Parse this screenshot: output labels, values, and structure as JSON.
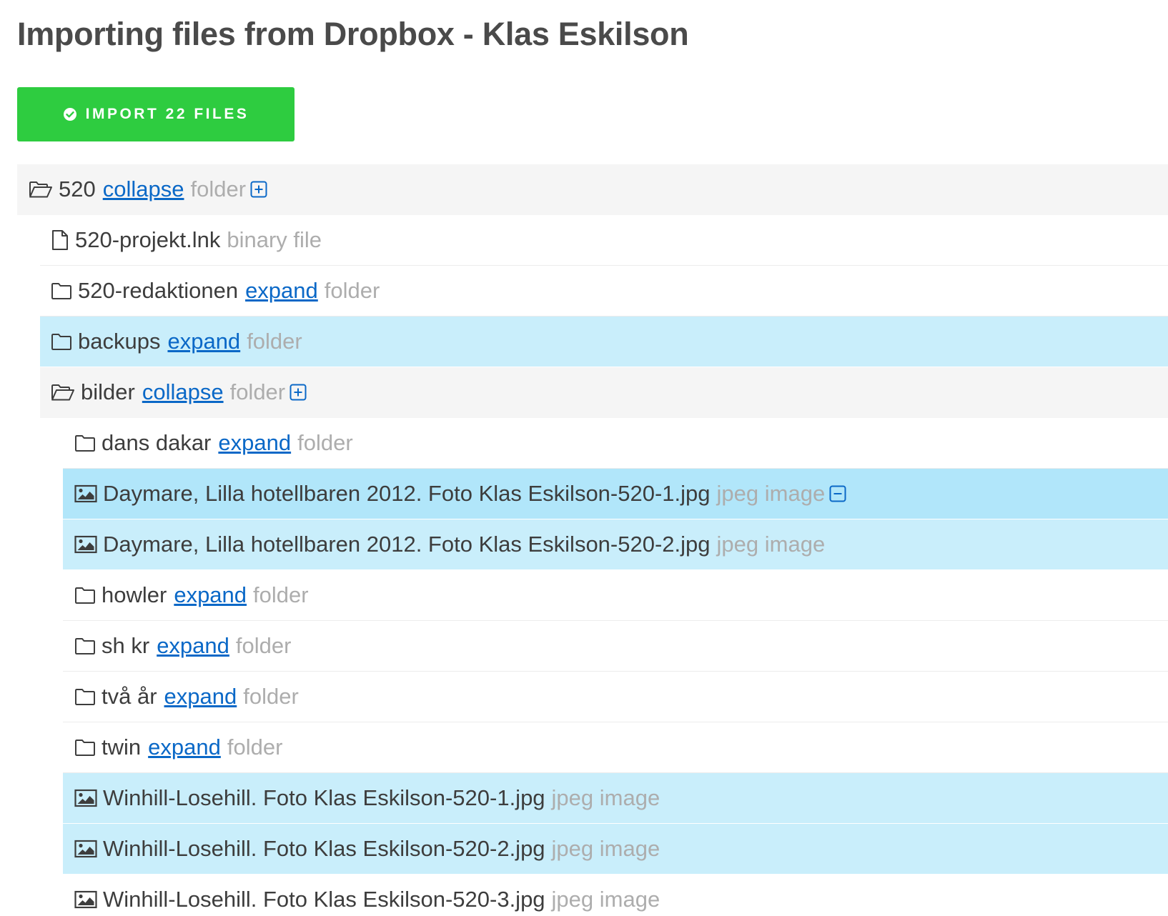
{
  "page": {
    "title": "Importing files from Dropbox - Klas Eskilson"
  },
  "import_button": {
    "icon": "check-circle-icon",
    "label": "IMPORT 22 FILES"
  },
  "colors": {
    "accent_green": "#2ecc40",
    "link_blue": "#0a68c7",
    "selected_row": "#c9eefb",
    "selected_row_hover": "#b1e6fa",
    "folder_open_row": "#f5f5f5"
  },
  "tree": [
    {
      "level": 0,
      "icon": "folder-open-icon",
      "name": "520",
      "toggle": "collapse",
      "type": "folder",
      "select_icon": "plus-square-icon",
      "state": "grey"
    },
    {
      "level": 1,
      "icon": "file-icon",
      "name": "520-projekt.lnk",
      "toggle": "",
      "type": "binary file",
      "select_icon": "",
      "state": ""
    },
    {
      "level": 1,
      "icon": "folder-icon",
      "name": "520-redaktionen",
      "toggle": "expand",
      "type": "folder",
      "select_icon": "",
      "state": ""
    },
    {
      "level": 1,
      "icon": "folder-icon",
      "name": "backups",
      "toggle": "expand",
      "type": "folder",
      "select_icon": "",
      "state": "sel"
    },
    {
      "level": 1,
      "icon": "folder-open-icon",
      "name": "bilder",
      "toggle": "collapse",
      "type": "folder",
      "select_icon": "plus-square-icon",
      "state": "grey"
    },
    {
      "level": 2,
      "icon": "folder-icon",
      "name": "dans dakar",
      "toggle": "expand",
      "type": "folder",
      "select_icon": "",
      "state": ""
    },
    {
      "level": 2,
      "icon": "image-icon",
      "name": "Daymare, Lilla hotellbaren 2012. Foto Klas Eskilson-520-1.jpg",
      "toggle": "",
      "type": "jpeg image",
      "select_icon": "minus-square-icon",
      "state": "sel-strong"
    },
    {
      "level": 2,
      "icon": "image-icon",
      "name": "Daymare, Lilla hotellbaren 2012. Foto Klas Eskilson-520-2.jpg",
      "toggle": "",
      "type": "jpeg image",
      "select_icon": "",
      "state": "sel"
    },
    {
      "level": 2,
      "icon": "folder-icon",
      "name": "howler",
      "toggle": "expand",
      "type": "folder",
      "select_icon": "",
      "state": ""
    },
    {
      "level": 2,
      "icon": "folder-icon",
      "name": "sh kr",
      "toggle": "expand",
      "type": "folder",
      "select_icon": "",
      "state": ""
    },
    {
      "level": 2,
      "icon": "folder-icon",
      "name": "två år",
      "toggle": "expand",
      "type": "folder",
      "select_icon": "",
      "state": ""
    },
    {
      "level": 2,
      "icon": "folder-icon",
      "name": "twin",
      "toggle": "expand",
      "type": "folder",
      "select_icon": "",
      "state": ""
    },
    {
      "level": 2,
      "icon": "image-icon",
      "name": "Winhill-Losehill. Foto Klas Eskilson-520-1.jpg",
      "toggle": "",
      "type": "jpeg image",
      "select_icon": "",
      "state": "sel"
    },
    {
      "level": 2,
      "icon": "image-icon",
      "name": "Winhill-Losehill. Foto Klas Eskilson-520-2.jpg",
      "toggle": "",
      "type": "jpeg image",
      "select_icon": "",
      "state": "sel"
    },
    {
      "level": 2,
      "icon": "image-icon",
      "name": "Winhill-Losehill. Foto Klas Eskilson-520-3.jpg",
      "toggle": "",
      "type": "jpeg image",
      "select_icon": "",
      "state": ""
    }
  ]
}
